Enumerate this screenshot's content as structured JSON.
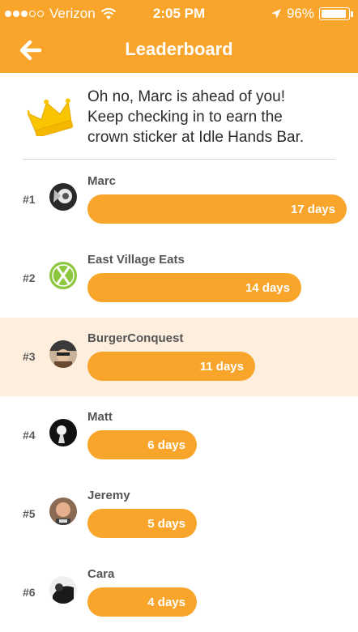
{
  "status_bar": {
    "carrier": "Verizon",
    "time": "2:05 PM",
    "battery": "96%",
    "battery_level": 0.96
  },
  "nav": {
    "title": "Leaderboard",
    "back_icon": "arrow-left-icon"
  },
  "banner": {
    "icon": "crown-icon",
    "line1": "Oh no, Marc is ahead of you!",
    "line2": "Keep checking in to earn the",
    "line3": "crown sticker at Idle Hands Bar."
  },
  "colors": {
    "accent": "#f9a52b",
    "highlight": "#fdeedd"
  },
  "leaderboard": [
    {
      "rank": "#1",
      "name": "Marc",
      "days": "17 days",
      "value": 17
    },
    {
      "rank": "#2",
      "name": "East Village Eats",
      "days": "14 days",
      "value": 14
    },
    {
      "rank": "#3",
      "name": "BurgerConquest",
      "days": "11 days",
      "value": 11,
      "highlight": true
    },
    {
      "rank": "#4",
      "name": "Matt",
      "days": "6 days",
      "value": 6
    },
    {
      "rank": "#5",
      "name": "Jeremy",
      "days": "5 days",
      "value": 5
    },
    {
      "rank": "#6",
      "name": "Cara",
      "days": "4 days",
      "value": 4
    }
  ]
}
